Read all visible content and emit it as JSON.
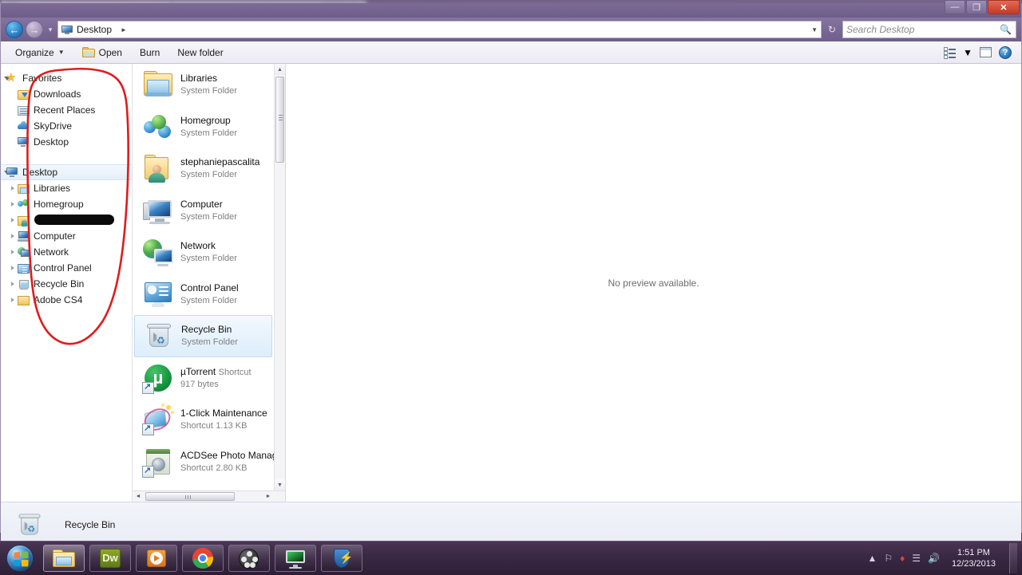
{
  "window": {
    "title": "Desktop",
    "controls": {
      "minimize": "—",
      "maximize": "❐",
      "close": "✕"
    }
  },
  "addressbar": {
    "breadcrumb": "Desktop",
    "breadcrumb_separator": "►",
    "dropdown_caret": "▼",
    "refresh_label": "↻",
    "back_label": "←",
    "forward_label": "→",
    "recent_caret": "▾"
  },
  "search": {
    "placeholder": "Search Desktop",
    "icon": "search-icon"
  },
  "commandbar": {
    "organize": "Organize",
    "organize_caret": "▼",
    "open": "Open",
    "burn": "Burn",
    "new_folder": "New folder",
    "view_caret": "▼",
    "help": "?"
  },
  "navpane": {
    "favorites": {
      "label": "Favorites",
      "icon": "star-icon",
      "expanded": true,
      "children": [
        {
          "label": "Downloads",
          "icon": "downloads-icon"
        },
        {
          "label": "Recent Places",
          "icon": "recent-places-icon"
        },
        {
          "label": "SkyDrive",
          "icon": "skydrive-cloud-icon"
        },
        {
          "label": "Desktop",
          "icon": "monitor-icon"
        }
      ]
    },
    "desktop": {
      "label": "Desktop",
      "icon": "monitor-icon",
      "expanded": true,
      "selected": true,
      "children": [
        {
          "label": "Libraries",
          "icon": "libraries-icon"
        },
        {
          "label": "Homegroup",
          "icon": "homegroup-icon"
        },
        {
          "label": "",
          "icon": "user-folder-icon",
          "redacted": true
        },
        {
          "label": "Computer",
          "icon": "computer-icon"
        },
        {
          "label": "Network",
          "icon": "network-icon"
        },
        {
          "label": "Control Panel",
          "icon": "control-panel-icon"
        },
        {
          "label": "Recycle Bin",
          "icon": "recycle-bin-icon"
        },
        {
          "label": "Adobe CS4",
          "icon": "folder-icon"
        }
      ]
    },
    "annotation": {
      "type": "red-circle-markup",
      "color": "#e01b1b"
    }
  },
  "filelist": {
    "items": [
      {
        "name": "Libraries",
        "type": "System Folder",
        "size": "",
        "icon": "libraries-icon",
        "selected": false,
        "shortcut": false
      },
      {
        "name": "Homegroup",
        "type": "System Folder",
        "size": "",
        "icon": "homegroup-icon",
        "selected": false,
        "shortcut": false
      },
      {
        "name": "stephaniepascalita",
        "type": "System Folder",
        "size": "",
        "icon": "user-folder-icon",
        "selected": false,
        "shortcut": false
      },
      {
        "name": "Computer",
        "type": "System Folder",
        "size": "",
        "icon": "computer-icon",
        "selected": false,
        "shortcut": false
      },
      {
        "name": "Network",
        "type": "System Folder",
        "size": "",
        "icon": "network-icon",
        "selected": false,
        "shortcut": false
      },
      {
        "name": "Control Panel",
        "type": "System Folder",
        "size": "",
        "icon": "control-panel-icon",
        "selected": false,
        "shortcut": false
      },
      {
        "name": "Recycle Bin",
        "type": "System Folder",
        "size": "",
        "icon": "recycle-bin-icon",
        "selected": true,
        "shortcut": false
      },
      {
        "name": "µTorrent",
        "type": "Shortcut",
        "size": "917 bytes",
        "icon": "utorrent-icon",
        "selected": false,
        "shortcut": true
      },
      {
        "name": "1-Click Maintenance",
        "type": "Shortcut",
        "size": "1.13 KB",
        "icon": "maintenance-icon",
        "selected": false,
        "shortcut": true
      },
      {
        "name": "ACDSee Photo Manag",
        "type": "Shortcut",
        "size": "2.80 KB",
        "icon": "acdsee-icon",
        "selected": false,
        "shortcut": true
      }
    ],
    "vscroll": {
      "up": "▲",
      "down": "▼"
    },
    "hscroll": {
      "left": "◄",
      "right": "►"
    }
  },
  "preview": {
    "message": "No preview available."
  },
  "details": {
    "name": "Recycle Bin",
    "icon": "recycle-bin-icon"
  },
  "taskbar": {
    "start": "start-orb",
    "buttons": [
      {
        "name": "windows-explorer",
        "icon": "explorer-icon",
        "active": true
      },
      {
        "name": "dreamweaver",
        "icon": "dw-icon",
        "label": "Dw",
        "active": false
      },
      {
        "name": "media-player",
        "icon": "wmp-icon",
        "active": false
      },
      {
        "name": "google-chrome",
        "icon": "chrome-icon",
        "active": false
      },
      {
        "name": "media-app",
        "icon": "film-reel-icon",
        "active": false
      },
      {
        "name": "monitor-app",
        "icon": "monitor-app-icon",
        "active": false
      },
      {
        "name": "security-app",
        "icon": "shield-icon",
        "active": false
      }
    ],
    "tray": {
      "show_hidden": "▲",
      "icons": [
        "flag-icon",
        "antivirus-icon",
        "network-signal-icon",
        "volume-icon"
      ],
      "time": "1:51 PM",
      "date": "12/23/2013"
    }
  }
}
